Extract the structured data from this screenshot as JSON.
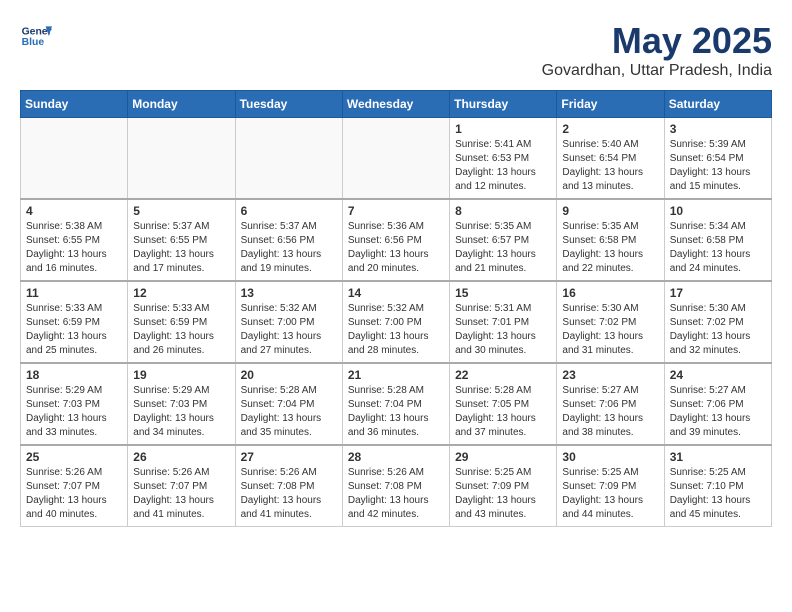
{
  "header": {
    "logo_line1": "General",
    "logo_line2": "Blue",
    "month": "May 2025",
    "location": "Govardhan, Uttar Pradesh, India"
  },
  "weekdays": [
    "Sunday",
    "Monday",
    "Tuesday",
    "Wednesday",
    "Thursday",
    "Friday",
    "Saturday"
  ],
  "weeks": [
    [
      {
        "day": "",
        "info": ""
      },
      {
        "day": "",
        "info": ""
      },
      {
        "day": "",
        "info": ""
      },
      {
        "day": "",
        "info": ""
      },
      {
        "day": "1",
        "info": "Sunrise: 5:41 AM\nSunset: 6:53 PM\nDaylight: 13 hours\nand 12 minutes."
      },
      {
        "day": "2",
        "info": "Sunrise: 5:40 AM\nSunset: 6:54 PM\nDaylight: 13 hours\nand 13 minutes."
      },
      {
        "day": "3",
        "info": "Sunrise: 5:39 AM\nSunset: 6:54 PM\nDaylight: 13 hours\nand 15 minutes."
      }
    ],
    [
      {
        "day": "4",
        "info": "Sunrise: 5:38 AM\nSunset: 6:55 PM\nDaylight: 13 hours\nand 16 minutes."
      },
      {
        "day": "5",
        "info": "Sunrise: 5:37 AM\nSunset: 6:55 PM\nDaylight: 13 hours\nand 17 minutes."
      },
      {
        "day": "6",
        "info": "Sunrise: 5:37 AM\nSunset: 6:56 PM\nDaylight: 13 hours\nand 19 minutes."
      },
      {
        "day": "7",
        "info": "Sunrise: 5:36 AM\nSunset: 6:56 PM\nDaylight: 13 hours\nand 20 minutes."
      },
      {
        "day": "8",
        "info": "Sunrise: 5:35 AM\nSunset: 6:57 PM\nDaylight: 13 hours\nand 21 minutes."
      },
      {
        "day": "9",
        "info": "Sunrise: 5:35 AM\nSunset: 6:58 PM\nDaylight: 13 hours\nand 22 minutes."
      },
      {
        "day": "10",
        "info": "Sunrise: 5:34 AM\nSunset: 6:58 PM\nDaylight: 13 hours\nand 24 minutes."
      }
    ],
    [
      {
        "day": "11",
        "info": "Sunrise: 5:33 AM\nSunset: 6:59 PM\nDaylight: 13 hours\nand 25 minutes."
      },
      {
        "day": "12",
        "info": "Sunrise: 5:33 AM\nSunset: 6:59 PM\nDaylight: 13 hours\nand 26 minutes."
      },
      {
        "day": "13",
        "info": "Sunrise: 5:32 AM\nSunset: 7:00 PM\nDaylight: 13 hours\nand 27 minutes."
      },
      {
        "day": "14",
        "info": "Sunrise: 5:32 AM\nSunset: 7:00 PM\nDaylight: 13 hours\nand 28 minutes."
      },
      {
        "day": "15",
        "info": "Sunrise: 5:31 AM\nSunset: 7:01 PM\nDaylight: 13 hours\nand 30 minutes."
      },
      {
        "day": "16",
        "info": "Sunrise: 5:30 AM\nSunset: 7:02 PM\nDaylight: 13 hours\nand 31 minutes."
      },
      {
        "day": "17",
        "info": "Sunrise: 5:30 AM\nSunset: 7:02 PM\nDaylight: 13 hours\nand 32 minutes."
      }
    ],
    [
      {
        "day": "18",
        "info": "Sunrise: 5:29 AM\nSunset: 7:03 PM\nDaylight: 13 hours\nand 33 minutes."
      },
      {
        "day": "19",
        "info": "Sunrise: 5:29 AM\nSunset: 7:03 PM\nDaylight: 13 hours\nand 34 minutes."
      },
      {
        "day": "20",
        "info": "Sunrise: 5:28 AM\nSunset: 7:04 PM\nDaylight: 13 hours\nand 35 minutes."
      },
      {
        "day": "21",
        "info": "Sunrise: 5:28 AM\nSunset: 7:04 PM\nDaylight: 13 hours\nand 36 minutes."
      },
      {
        "day": "22",
        "info": "Sunrise: 5:28 AM\nSunset: 7:05 PM\nDaylight: 13 hours\nand 37 minutes."
      },
      {
        "day": "23",
        "info": "Sunrise: 5:27 AM\nSunset: 7:06 PM\nDaylight: 13 hours\nand 38 minutes."
      },
      {
        "day": "24",
        "info": "Sunrise: 5:27 AM\nSunset: 7:06 PM\nDaylight: 13 hours\nand 39 minutes."
      }
    ],
    [
      {
        "day": "25",
        "info": "Sunrise: 5:26 AM\nSunset: 7:07 PM\nDaylight: 13 hours\nand 40 minutes."
      },
      {
        "day": "26",
        "info": "Sunrise: 5:26 AM\nSunset: 7:07 PM\nDaylight: 13 hours\nand 41 minutes."
      },
      {
        "day": "27",
        "info": "Sunrise: 5:26 AM\nSunset: 7:08 PM\nDaylight: 13 hours\nand 41 minutes."
      },
      {
        "day": "28",
        "info": "Sunrise: 5:26 AM\nSunset: 7:08 PM\nDaylight: 13 hours\nand 42 minutes."
      },
      {
        "day": "29",
        "info": "Sunrise: 5:25 AM\nSunset: 7:09 PM\nDaylight: 13 hours\nand 43 minutes."
      },
      {
        "day": "30",
        "info": "Sunrise: 5:25 AM\nSunset: 7:09 PM\nDaylight: 13 hours\nand 44 minutes."
      },
      {
        "day": "31",
        "info": "Sunrise: 5:25 AM\nSunset: 7:10 PM\nDaylight: 13 hours\nand 45 minutes."
      }
    ]
  ]
}
